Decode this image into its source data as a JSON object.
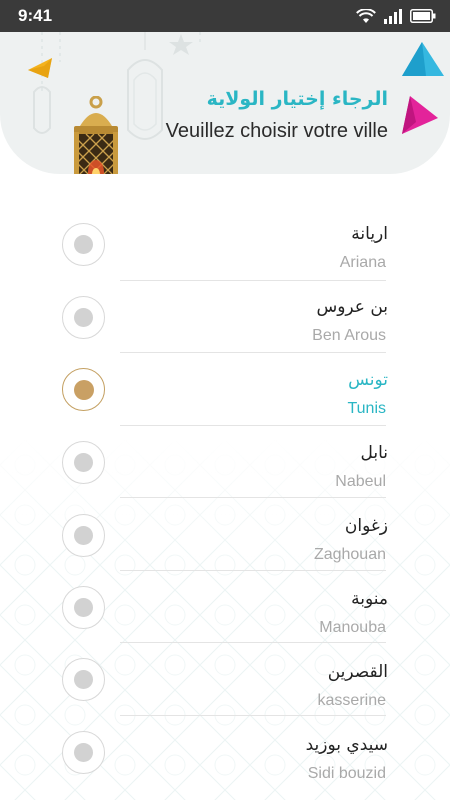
{
  "status_bar": {
    "time": "9:41"
  },
  "header": {
    "title_ar": "الرجاء إختيار الولاية",
    "title_fr": "Veuillez choisir votre ville"
  },
  "colors": {
    "accent": "#2ab6c4",
    "selected_radio": "#c9a064",
    "status_bar": "#3a3a3a"
  },
  "cities": [
    {
      "name_ar": "اريانة",
      "name_fr": "Ariana",
      "selected": false
    },
    {
      "name_ar": "بن عروس",
      "name_fr": "Ben Arous",
      "selected": false
    },
    {
      "name_ar": "تونس",
      "name_fr": "Tunis",
      "selected": true
    },
    {
      "name_ar": "نابل",
      "name_fr": "Nabeul",
      "selected": false
    },
    {
      "name_ar": "زغوان",
      "name_fr": "Zaghouan",
      "selected": false
    },
    {
      "name_ar": "منوبة",
      "name_fr": "Manouba",
      "selected": false
    },
    {
      "name_ar": "القصرين",
      "name_fr": "kasserine",
      "selected": false
    },
    {
      "name_ar": "سيدي بوزيد",
      "name_fr": "Sidi bouzid",
      "selected": false
    }
  ]
}
